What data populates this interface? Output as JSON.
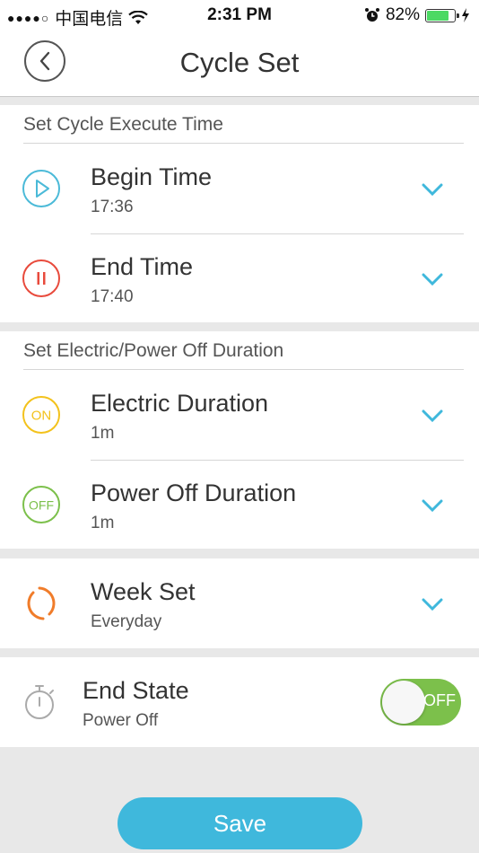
{
  "status_bar": {
    "signal_dots": "●●●●○",
    "carrier": "中国电信",
    "time": "2:31 PM",
    "battery_percent": "82%",
    "battery_level": 0.82
  },
  "nav": {
    "title": "Cycle Set"
  },
  "execute_section": {
    "header": "Set Cycle Execute Time",
    "begin": {
      "title": "Begin Time",
      "value": "17:36"
    },
    "end": {
      "title": "End Time",
      "value": "17:40"
    }
  },
  "duration_section": {
    "header": "Set Electric/Power Off Duration",
    "electric": {
      "title": "Electric Duration",
      "value": "1m",
      "icon_text": "ON"
    },
    "power_off": {
      "title": "Power Off Duration",
      "value": "1m",
      "icon_text": "OFF"
    }
  },
  "week": {
    "title": "Week Set",
    "value": "Everyday"
  },
  "end_state": {
    "title": "End State",
    "value": "Power Off",
    "toggle_label": "OFF"
  },
  "save_label": "Save",
  "colors": {
    "accent": "#3fb8dc",
    "begin_icon": "#4bbad8",
    "end_icon": "#e84a3c",
    "on_icon": "#f3c21c",
    "off_icon": "#7cc04b",
    "week_icon": "#f07c2a",
    "toggle": "#7cc04b"
  }
}
